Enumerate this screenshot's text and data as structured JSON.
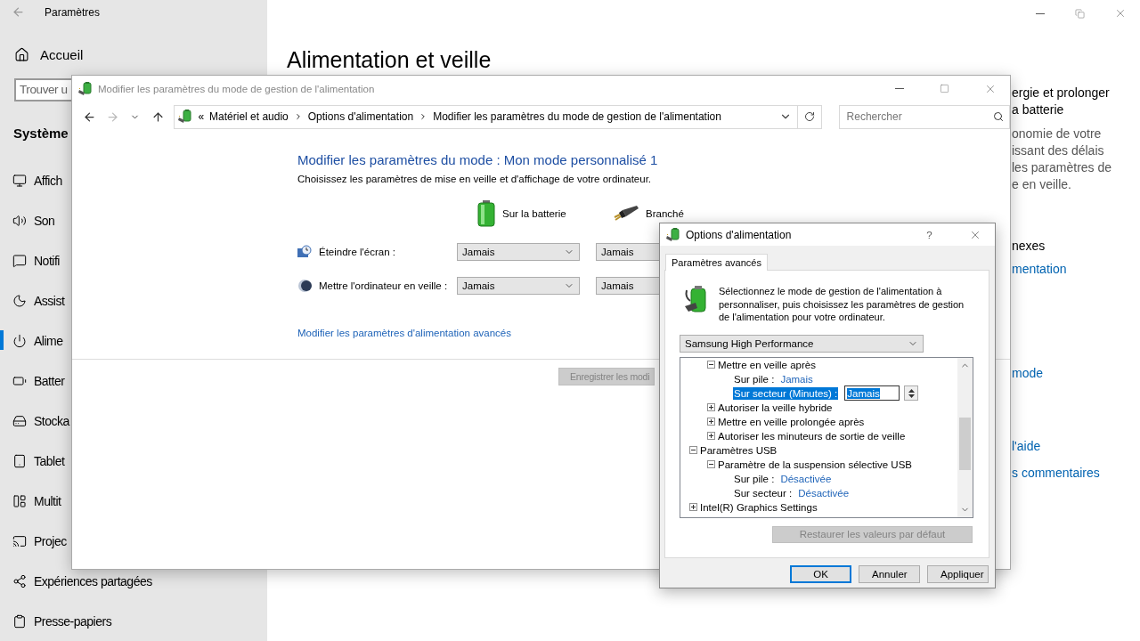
{
  "settings": {
    "title": "Paramètres",
    "home": "Accueil",
    "search": {
      "placeholder": "Trouver u"
    },
    "section": "Système",
    "nav": [
      {
        "label": "Affich",
        "selected": false
      },
      {
        "label": "Son",
        "selected": false
      },
      {
        "label": "Notifi",
        "selected": false
      },
      {
        "label": "Assist",
        "selected": false
      },
      {
        "label": "Alime",
        "selected": true
      },
      {
        "label": "Batter",
        "selected": false
      },
      {
        "label": "Stocka",
        "selected": false
      },
      {
        "label": "Tablet",
        "selected": false
      },
      {
        "label": "Multit",
        "selected": false
      },
      {
        "label": "Projec",
        "selected": false
      },
      {
        "label": "Expériences partagées",
        "selected": false
      },
      {
        "label": "Presse-papiers",
        "selected": false
      }
    ],
    "page_title": "Alimentation et veille",
    "side": [
      {
        "kind": "heading",
        "text": "ergie et prolonger"
      },
      {
        "kind": "heading",
        "text": "a batterie"
      },
      {
        "kind": "text",
        "text": "onomie de votre"
      },
      {
        "kind": "text",
        "text": "issant des délais"
      },
      {
        "kind": "text",
        "text": "les paramètres de"
      },
      {
        "kind": "text",
        "text": "e en veille."
      },
      {
        "kind": "heading",
        "text": "nexes"
      },
      {
        "kind": "link",
        "text": "mentation"
      },
      {
        "kind": "link",
        "text": "mode"
      },
      {
        "kind": "link",
        "text": "l'aide"
      },
      {
        "kind": "link",
        "text": "s commentaires"
      }
    ]
  },
  "control_panel": {
    "title": "Modifier les paramètres du mode de gestion de l'alimentation",
    "address": {
      "prefix": "«",
      "crumbs": [
        "Matériel et audio",
        "Options d'alimentation",
        "Modifier les paramètres du mode de gestion de l'alimentation"
      ]
    },
    "search": {
      "placeholder": "Rechercher"
    },
    "heading": "Modifier les paramètres du mode : Mon mode personnalisé 1",
    "subheading": "Choisissez les paramètres de mise en veille et d'affichage de votre ordinateur.",
    "columns": [
      "Sur la batterie",
      "Branché"
    ],
    "rows": [
      {
        "label": "Éteindre l'écran :",
        "values": [
          "Jamais",
          "Jamais"
        ]
      },
      {
        "label": "Mettre l'ordinateur en veille :",
        "values": [
          "Jamais",
          "Jamais"
        ]
      }
    ],
    "link": "Modifier les paramètres d'alimentation avancés",
    "save_button": {
      "label": "Enregistrer les modi",
      "disabled": true
    }
  },
  "dialog": {
    "title": "Options d'alimentation",
    "help": "?",
    "tabs": [
      {
        "label": "Paramètres avancés",
        "selected": true
      }
    ],
    "description": "Sélectionnez le mode de gestion de l'alimentation à personnaliser, puis choisissez les paramètres de gestion de l'alimentation pour votre ordinateur.",
    "plan": "Samsung High Performance",
    "tree": [
      {
        "kind": "group",
        "children": [
          {
            "kind": "node",
            "label": "Mettre en veille après",
            "expanded": true,
            "children": [
              {
                "kind": "setting",
                "label": "Sur pile :",
                "value": "Jamais",
                "selected": false
              },
              {
                "kind": "spinner",
                "label": "Sur secteur (Minutes) :",
                "value": "Jamais",
                "selected": true
              }
            ]
          },
          {
            "kind": "node",
            "label": "Autoriser la veille hybride",
            "expanded": false
          },
          {
            "kind": "node",
            "label": "Mettre en veille prolongée après",
            "expanded": false
          },
          {
            "kind": "node",
            "label": "Autoriser les minuteurs de sortie de veille",
            "expanded": false
          }
        ]
      },
      {
        "kind": "node",
        "label": "Paramètres USB",
        "expanded": true,
        "children": [
          {
            "kind": "node",
            "label": "Paramètre de la suspension sélective USB",
            "expanded": true,
            "children": [
              {
                "kind": "setting",
                "label": "Sur pile :",
                "value": "Désactivée",
                "selected": false
              },
              {
                "kind": "setting",
                "label": "Sur secteur :",
                "value": "Désactivée",
                "selected": false
              }
            ]
          }
        ]
      },
      {
        "kind": "node",
        "label": "Intel(R) Graphics Settings",
        "expanded": false
      }
    ],
    "restore_button": {
      "label": "Restaurer les valeurs par défaut",
      "disabled": true
    },
    "buttons": [
      {
        "label": "OK",
        "default": true
      },
      {
        "label": "Annuler",
        "default": false
      },
      {
        "label": "Appliquer",
        "default": false
      }
    ]
  }
}
